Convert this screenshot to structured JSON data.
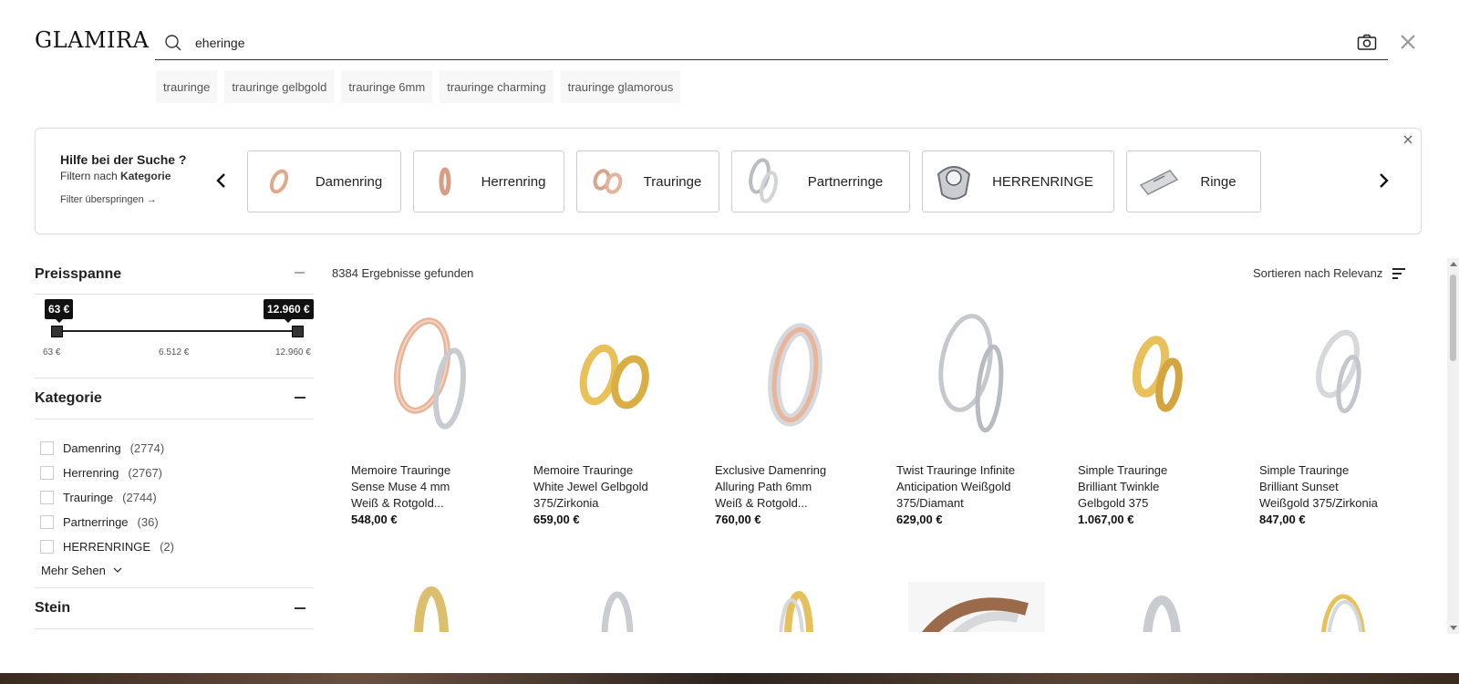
{
  "brand": {
    "logo": "GLAMIRA"
  },
  "search": {
    "value": "eheringe",
    "icon": "search-icon",
    "camera_icon": "camera-icon",
    "close_icon": "close-icon"
  },
  "suggestions": [
    "trauringe",
    "trauringe gelbgold",
    "trauringe 6mm",
    "trauringe charming",
    "trauringe glamorous"
  ],
  "help": {
    "title": "Hilfe bei der Suche ?",
    "subtitle_prefix": "Filtern nach",
    "subtitle_bold": "Kategorie",
    "skip": "Filter überspringen →",
    "categories": [
      {
        "label": "Damenring",
        "thumb": "rose-gold"
      },
      {
        "label": "Herrenring",
        "thumb": "rose-gold-single"
      },
      {
        "label": "Trauringe",
        "thumb": "rose-gold-pair"
      },
      {
        "label": "Partnerringe",
        "thumb": "silver-pair"
      },
      {
        "label": "HERRENRINGE",
        "thumb": "silver-signet"
      },
      {
        "label": "Ringe",
        "thumb": "silver-band"
      }
    ]
  },
  "filters": {
    "price": {
      "title": "Preisspanne",
      "min_tag": "63 €",
      "max_tag": "12.960 €",
      "scale_min": "63 €",
      "scale_mid": "6.512 €",
      "scale_max": "12.960 €",
      "selected_min_fraction": 0,
      "selected_max_fraction": 1
    },
    "category": {
      "title": "Kategorie",
      "items": [
        {
          "label": "Damenring",
          "count": "(2774)"
        },
        {
          "label": "Herrenring",
          "count": "(2767)"
        },
        {
          "label": "Trauringe",
          "count": "(2744)"
        },
        {
          "label": "Partnerringe",
          "count": "(36)"
        },
        {
          "label": "HERRENRINGE",
          "count": "(2)"
        }
      ],
      "more": "Mehr Sehen"
    },
    "stone": {
      "title": "Stein"
    }
  },
  "results": {
    "count_text": "8384 Ergebnisse gefunden",
    "sort_label": "Sortieren nach Relevanz",
    "products": [
      {
        "line1": "Memoire Trauringe",
        "line2": "Sense Muse 4 mm",
        "line3": "Weiß & Rotgold...",
        "price": "548,00 €",
        "metal": "white-rose"
      },
      {
        "line1": "Memoire Trauringe",
        "line2": "White Jewel Gelbgold",
        "line3": "375/Zirkonia",
        "price": "659,00 €",
        "metal": "yellow"
      },
      {
        "line1": "Exclusive Damenring",
        "line2": "Alluring Path 6mm",
        "line3": "Weiß & Rotgold...",
        "price": "760,00 €",
        "metal": "white-rose"
      },
      {
        "line1": "Twist Trauringe Infinite",
        "line2": "Anticipation Weißgold",
        "line3": "375/Diamant",
        "price": "629,00 €",
        "metal": "white"
      },
      {
        "line1": "Simple Trauringe",
        "line2": "Brilliant Twinkle",
        "line3": "Gelbgold 375",
        "price": "1.067,00 €",
        "metal": "yellow"
      },
      {
        "line1": "Simple Trauringe",
        "line2": "Brilliant Sunset",
        "line3": "Weißgold 375/Zirkonia",
        "price": "847,00 €",
        "metal": "white"
      }
    ]
  },
  "colors": {
    "rose_gold": "#e8b49a",
    "yellow_gold": "#e8c15a",
    "white_gold": "#d6d8dc"
  }
}
